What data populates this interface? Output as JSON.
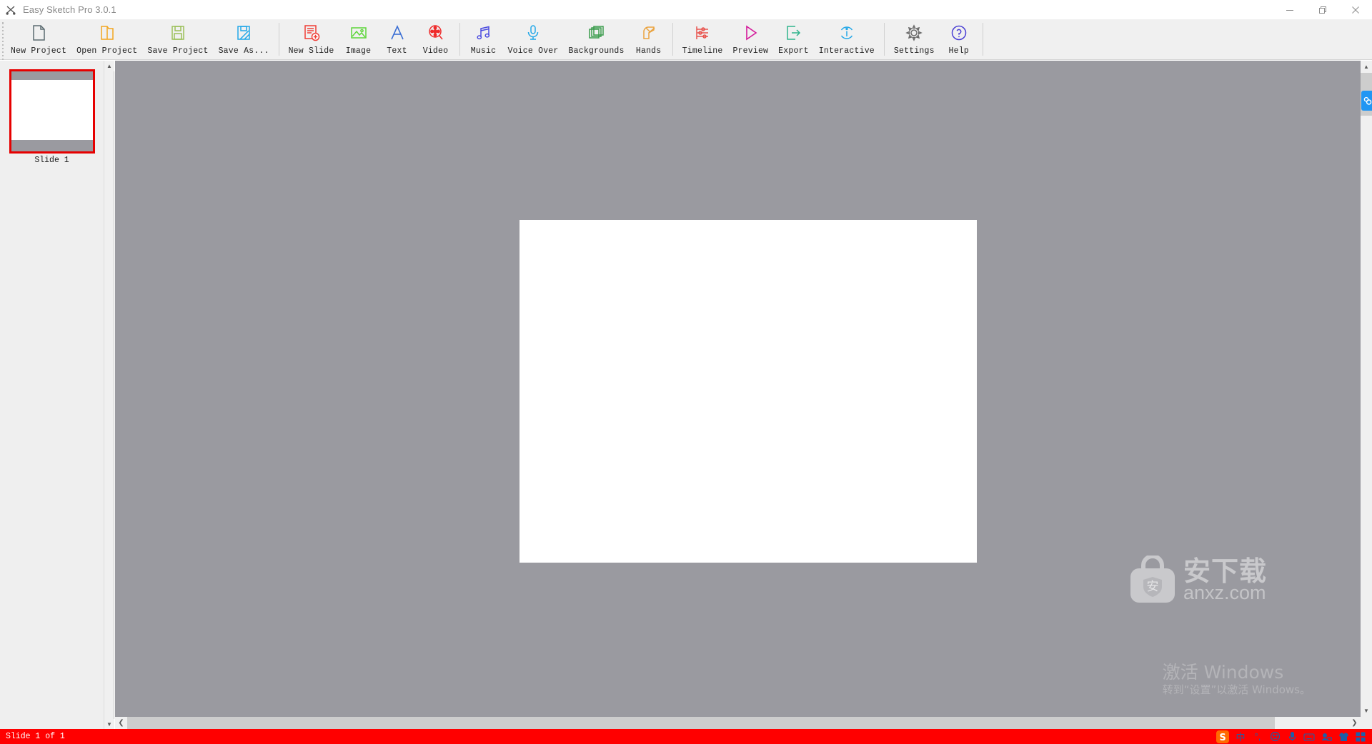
{
  "window": {
    "title": "Easy Sketch Pro 3.0.1",
    "app_icon": "scissors-icon",
    "minimize_label": "—",
    "maximize_label": "❐",
    "close_label": "✕"
  },
  "toolbar": {
    "groups": [
      {
        "name": "file",
        "items": [
          {
            "label": "New Project",
            "icon": "new-document-icon",
            "color": "#5b6b70"
          },
          {
            "label": "Open Project",
            "icon": "open-folder-icon",
            "color": "#f2a51e"
          },
          {
            "label": "Save Project",
            "icon": "floppy-disk-icon",
            "color": "#9bbf59"
          },
          {
            "label": "Save As...",
            "icon": "save-as-icon",
            "color": "#22a7e8"
          }
        ]
      },
      {
        "name": "insert",
        "items": [
          {
            "label": "New Slide",
            "icon": "new-slide-icon",
            "color": "#ef3e36"
          },
          {
            "label": "Image",
            "icon": "image-icon",
            "color": "#5ed63a"
          },
          {
            "label": "Text",
            "icon": "text-a-icon",
            "color": "#3b6fd4"
          },
          {
            "label": "Video",
            "icon": "video-reel-icon",
            "color": "#ef2b2b"
          }
        ]
      },
      {
        "name": "media",
        "items": [
          {
            "label": "Music",
            "icon": "music-note-icon",
            "color": "#4a4ae0"
          },
          {
            "label": "Voice Over",
            "icon": "microphone-icon",
            "color": "#22a7e8"
          },
          {
            "label": "Backgrounds",
            "icon": "layers-icon",
            "color": "#3a9c4c"
          },
          {
            "label": "Hands",
            "icon": "hand-pen-icon",
            "color": "#eaa33f"
          }
        ]
      },
      {
        "name": "production",
        "items": [
          {
            "label": "Timeline",
            "icon": "sliders-icon",
            "color": "#e8544f"
          },
          {
            "label": "Preview",
            "icon": "play-triangle-icon",
            "color": "#d4189a"
          },
          {
            "label": "Export",
            "icon": "export-arrow-icon",
            "color": "#2fb48c"
          },
          {
            "label": "Interactive",
            "icon": "info-circle-icon",
            "color": "#22a7e8"
          }
        ]
      },
      {
        "name": "system",
        "items": [
          {
            "label": "Settings",
            "icon": "gear-icon",
            "color": "#6b6b6b"
          },
          {
            "label": "Help",
            "icon": "question-circle-icon",
            "color": "#4a3fd4"
          }
        ]
      }
    ]
  },
  "slide_panel": {
    "slides": [
      {
        "label": "Slide 1",
        "selected": true
      }
    ],
    "selection_color": "#e60000",
    "scroll_up": "▲",
    "scroll_down": "▼"
  },
  "canvas": {
    "background_color": "#9a9aa0",
    "slide_color": "#ffffff",
    "watermark": {
      "cn_text": "安下载",
      "en_text": "anxz.com",
      "bag_icon": "shopping-bag-icon",
      "bag_glyph": "安"
    }
  },
  "scrollbars": {
    "vertical_up": "▲",
    "vertical_down": "▼",
    "horizontal_left": "❮",
    "horizontal_right": "❯",
    "badge_icon": "link-badge-icon"
  },
  "windows_watermark": {
    "title": "激活 Windows",
    "subtitle": "转到“设置”以激活 Windows。"
  },
  "statusbar": {
    "text": "Slide 1 of 1",
    "background_color": "#ff0000",
    "ime": {
      "logo": "sogou-logo",
      "items": [
        {
          "icon": "chinese-mode-icon",
          "glyph": "中"
        },
        {
          "icon": "punctuation-icon",
          "glyph": "°,"
        },
        {
          "icon": "emoji-icon",
          "glyph": "☺"
        },
        {
          "icon": "microphone-icon",
          "glyph": "⬤"
        },
        {
          "icon": "soft-keyboard-icon",
          "glyph": "⌨"
        },
        {
          "icon": "user-card-icon",
          "glyph": "⬛"
        },
        {
          "icon": "skin-shirt-icon",
          "glyph": "⬛"
        },
        {
          "icon": "toolbox-grid-icon",
          "glyph": "⬛"
        }
      ]
    }
  }
}
